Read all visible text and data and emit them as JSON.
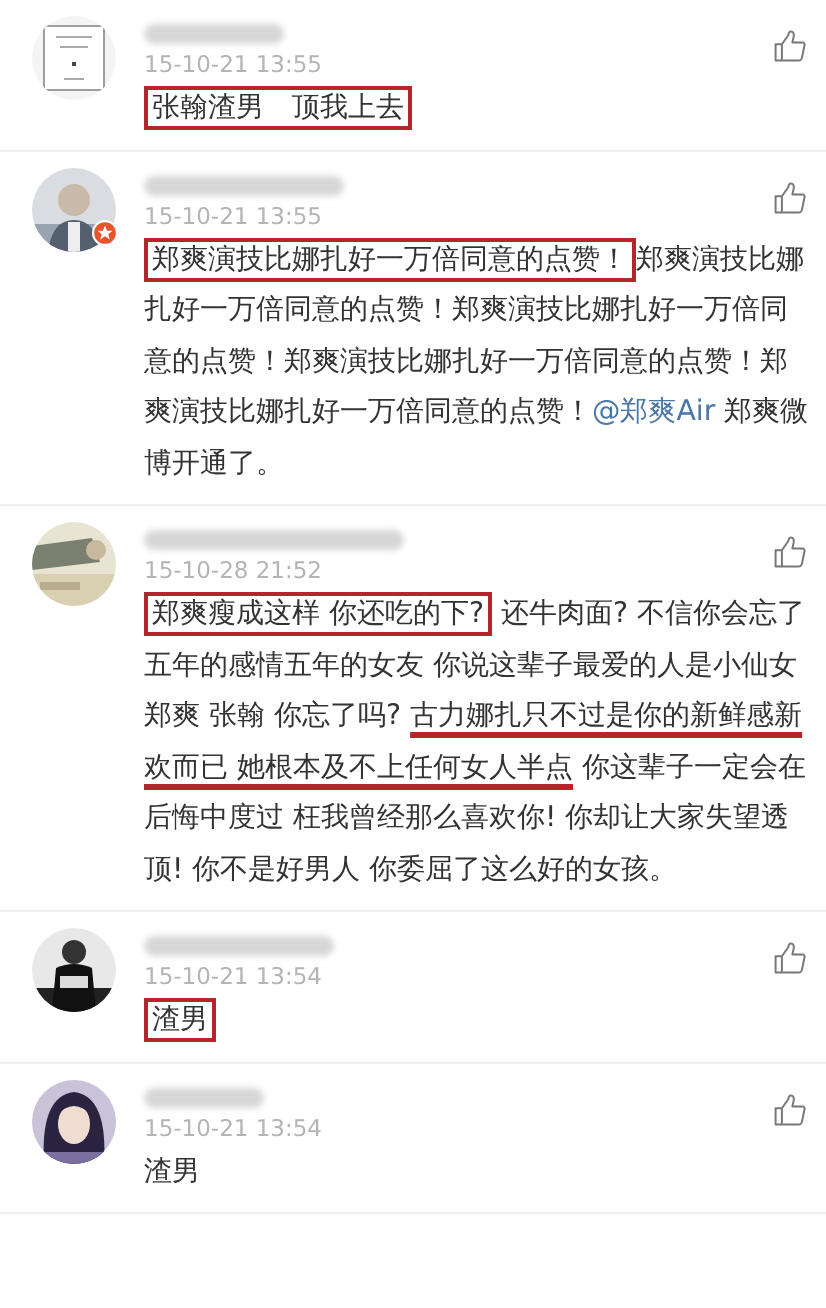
{
  "comments": [
    {
      "time": "15-10-21 13:55",
      "verified": false,
      "text": [
        {
          "kind": "box",
          "text": "张翰渣男　顶我上去"
        }
      ]
    },
    {
      "time": "15-10-21 13:55",
      "verified": true,
      "text": [
        {
          "kind": "box",
          "text": "郑爽演技比娜扎好一万倍同意的点赞！"
        },
        {
          "kind": "none",
          "text": "郑爽演技比娜扎好一万倍同意的点赞！郑爽演技比娜扎好一万倍同意的点赞！郑爽演技比娜扎好一万倍同意的点赞！郑爽演技比娜扎好一万倍同意的点赞！"
        },
        {
          "kind": "mention",
          "text": "@郑爽Air"
        },
        {
          "kind": "none",
          "text": " 郑爽微博开通了。"
        }
      ]
    },
    {
      "time": "15-10-28 21:52",
      "verified": false,
      "text": [
        {
          "kind": "box",
          "text": "郑爽瘦成这样 你还吃的下?"
        },
        {
          "kind": "none",
          "text": " 还牛肉面? 不信你会忘了五年的感情五年的女友 你说这辈子最爱的人是小仙女郑爽 张翰 你忘了吗? "
        },
        {
          "kind": "underline",
          "text": "古力娜扎只不过是你的新鲜感新欢而已 她根本及不上任何女人半点"
        },
        {
          "kind": "none",
          "text": " 你这辈子一定会在后悔中度过 枉我曾经那么喜欢你! 你却让大家失望透顶! 你不是好男人 你委屈了这么好的女孩。"
        }
      ]
    },
    {
      "time": "15-10-21 13:54",
      "verified": false,
      "text": [
        {
          "kind": "box",
          "text": "渣男"
        }
      ]
    },
    {
      "time": "15-10-21 13:54",
      "verified": false,
      "text": [
        {
          "kind": "none",
          "text": "渣男"
        }
      ]
    }
  ]
}
